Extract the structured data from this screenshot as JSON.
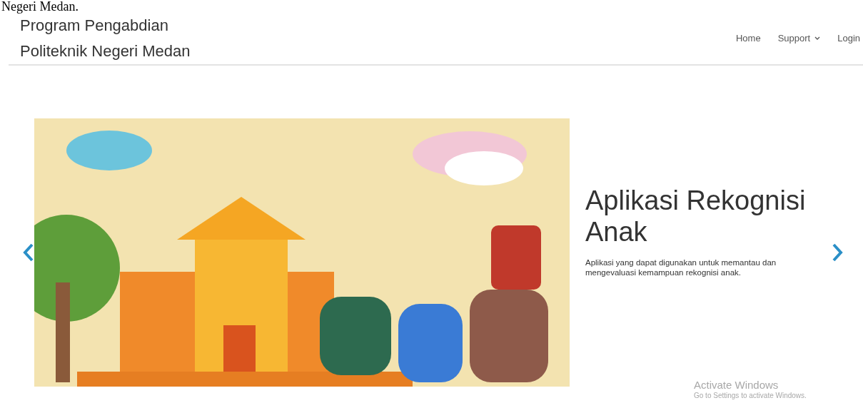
{
  "document_caption": "Negeri Medan.",
  "navbar": {
    "brand_lines": [
      "Program Pengabdian",
      "Politeknik Negeri Medan"
    ],
    "links": [
      {
        "label": "Home",
        "dropdown": false
      },
      {
        "label": "Support",
        "dropdown": true
      },
      {
        "label": "Login",
        "dropdown": false
      }
    ]
  },
  "carousel": {
    "slide": {
      "kind": "picture",
      "title": "Aplikasi Rekognisi Anak",
      "description": "Aplikasi yang dapat digunakan untuk memantau dan mengevaluasi kemampuan rekognisi anak."
    },
    "prev": true,
    "next": true
  },
  "os_watermark": {
    "title": "Activate Windows",
    "subtitle": "Go to Settings to activate Windows."
  }
}
